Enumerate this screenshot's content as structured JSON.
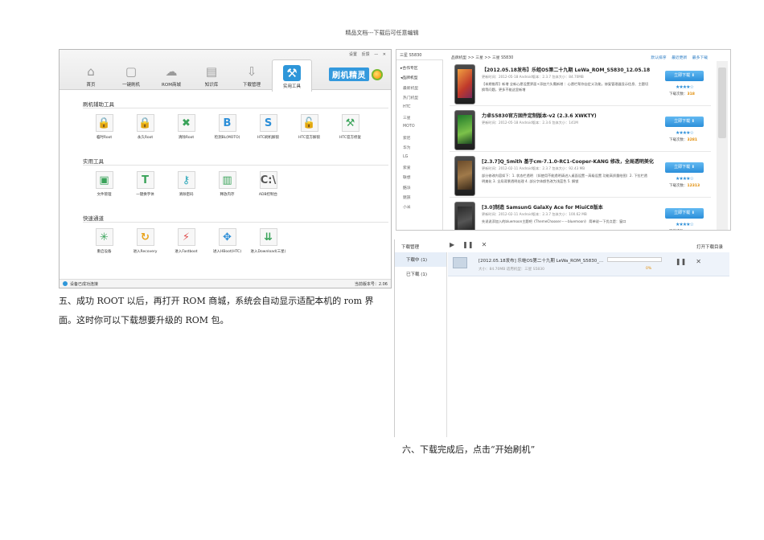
{
  "header": {
    "text": "精品文档---下载后可任意编辑"
  },
  "tool_window": {
    "window_controls": [
      "设置",
      "反馈",
      "—",
      "✕"
    ],
    "nav": [
      {
        "label": "首页",
        "icon": "home-icon",
        "glyph": "⌂"
      },
      {
        "label": "一键刷机",
        "icon": "flash-icon",
        "glyph": "▢"
      },
      {
        "label": "ROM商城",
        "icon": "cloud-download-icon",
        "glyph": "☁"
      },
      {
        "label": "知识库",
        "icon": "document-icon",
        "glyph": "▤"
      },
      {
        "label": "下载管理",
        "icon": "download-icon",
        "glyph": "⇩"
      },
      {
        "label": "实用工具",
        "icon": "tools-icon",
        "glyph": "⚒"
      }
    ],
    "brand": "刷机精灵",
    "sections": [
      {
        "title": "刷机辅助工具",
        "tools": [
          {
            "label": "临时Root",
            "icon": "lock-icon",
            "glyph": "🔒",
            "color": "#e8a21a"
          },
          {
            "label": "永久Root",
            "icon": "lock-icon",
            "glyph": "🔒",
            "color": "#e08a28"
          },
          {
            "label": "清除Root",
            "icon": "android-clear-icon",
            "glyph": "✖",
            "color": "#3aa35a"
          },
          {
            "label": "检测BL(MOTO)",
            "icon": "bootloader-icon",
            "glyph": "B",
            "color": "#2d8fd8"
          },
          {
            "label": "HTC刷机解锁",
            "icon": "s-off-icon",
            "glyph": "S",
            "color": "#2d8fd8"
          },
          {
            "label": "HTC官方解锁",
            "icon": "unlock-icon",
            "glyph": "🔓",
            "color": "#3aa35a"
          },
          {
            "label": "HTC官方修复",
            "icon": "hammer-icon",
            "glyph": "⚒",
            "color": "#3aa35a"
          }
        ]
      },
      {
        "title": "实用工具",
        "tools": [
          {
            "label": "文件管理",
            "icon": "folder-icon",
            "glyph": "▣",
            "color": "#3aa35a"
          },
          {
            "label": "一键换字体",
            "icon": "font-icon",
            "glyph": "T",
            "color": "#3aa35a"
          },
          {
            "label": "清除密码",
            "icon": "key-icon",
            "glyph": "⚷",
            "color": "#2aa6b8"
          },
          {
            "label": "释放内存",
            "icon": "memory-icon",
            "glyph": "▥",
            "color": "#3aa35a"
          },
          {
            "label": "ADB控制台",
            "icon": "console-icon",
            "glyph": "C:\\",
            "color": "#555555"
          }
        ]
      },
      {
        "title": "快速通道",
        "tools": [
          {
            "label": "重启设备",
            "icon": "restart-icon",
            "glyph": "✳",
            "color": "#3aa35a"
          },
          {
            "label": "进入Recovery",
            "icon": "recovery-icon",
            "glyph": "↻",
            "color": "#e8a21a"
          },
          {
            "label": "进入Fastboot",
            "icon": "fastboot-icon",
            "glyph": "⚡",
            "color": "#e05050"
          },
          {
            "label": "进入HBoot(HTC)",
            "icon": "hboot-icon",
            "glyph": "✥",
            "color": "#2d8fd8"
          },
          {
            "label": "进入Download(三星)",
            "icon": "download-mode-icon",
            "glyph": "⇊",
            "color": "#3aa35a"
          }
        ]
      }
    ],
    "status": {
      "text": "设备已成功连接",
      "version": "当前版本号：2.06"
    }
  },
  "step5": {
    "line1": "五、成功 ROOT 以后，再打开 ROM 商城，系统会自动显示适配本机的 rom 界",
    "line2": "面。这时你可以下载想要升级的 ROM 包。"
  },
  "step6": {
    "text": "六、下载完成后，点击“开始刷机”"
  },
  "rom_market": {
    "search": "三星 S5830",
    "sidebar": [
      {
        "label": "▸合作专区",
        "head": true
      },
      {
        "label": "◂品牌机型",
        "head": true
      },
      {
        "label": "最新机型",
        "head": false
      },
      {
        "label": "热门机型",
        "head": false
      },
      {
        "label": "HTC",
        "head": false
      },
      {
        "label": "三星",
        "head": false
      },
      {
        "label": "MOTO",
        "head": false
      },
      {
        "label": "索尼",
        "head": false
      },
      {
        "label": "华为",
        "head": false
      },
      {
        "label": "LG",
        "head": false
      },
      {
        "label": "索爱",
        "head": false
      },
      {
        "label": "联想",
        "head": false
      },
      {
        "label": "酷派",
        "head": false
      },
      {
        "label": "魅族",
        "head": false
      },
      {
        "label": "小米",
        "head": false
      }
    ],
    "breadcrumb": "品牌机型 >> 三星 >> 三星 S5830",
    "sort": [
      "默认排序",
      "最近更新",
      "最多下载"
    ],
    "download_label": "立即下载 ⬇",
    "count_label": "下载次数：",
    "roms": [
      {
        "title": "【2012.05.18发布】乐蛙OS第二十九期 LeWa_ROM_S5830_12.05.18",
        "meta": "更新时间：2012-05-18    Android版本：2.3.7    包体大小：84.70MB",
        "desc": "【本期推荐】新增 全新心愿设置界面+添加六头鹰新增 ：心愿栏帮你自定义功能，修复管理器显示信息、主题切换等问题，更多不能这里新增",
        "count": "318",
        "stars": "★★★★☆",
        "screen": "linear-gradient(135deg,#f0a040,#c0392b 60%,#7a2a5a)"
      },
      {
        "title": "力卓S5830官方固件定制版本-v2 (2.3.6 XWKTY)",
        "meta": "更新时间：2012-05-18    Android版本：2.3.6    包体大小：141M",
        "desc": "",
        "count": "3281",
        "stars": "★★★★☆",
        "screen": "linear-gradient(160deg,#1f7a2a,#7cc24a 60%,#1d4a22)"
      },
      {
        "title": "[2.3.7]Q_Smith 基于cm-7.1.0-RC1-Cooper-KANG 修改，全局透明美化",
        "meta": "更新时间：2012-02-11    Android版本：2.3.7    包体大小：92.43 MB",
        "desc": "部分修改内容如下：1. 状态栏透明 （如使用不能透明请进入桌面设置－高级设置 功能高质量绘图）2. 下拉栏透明美化 3. 全局背景透明处理 4. 部分字体颜色改为浅蓝色 5. 解锁",
        "count": "12313",
        "stars": "★★★★☆",
        "screen": "linear-gradient(160deg,#6b4b2a,#a07a4a 50%,#3a2a1a)"
      },
      {
        "title": "[3.0]制造 SamsunG GalaXy Ace for MiuiC8版本",
        "meta": "更新时间：2012-02-11    Android版本：2.3.7    包体大小：100.62 MB",
        "desc": "先说说添加入的bluemoon主题吧《ThemeChooser－－bluemoon》 简单说一下优点是：窗口",
        "count": "",
        "stars": "★★★★☆",
        "screen": "linear-gradient(160deg,#2a2a2a,#555 50%,#111)"
      }
    ]
  },
  "download_manager": {
    "title": "下载管理",
    "open_dir": "打开下载目录",
    "tabs": [
      {
        "label": "下载中 (1)",
        "active": true
      },
      {
        "label": "已下载 (1)",
        "active": false
      }
    ],
    "item": {
      "name": "[2012.05.18发布] 乐蛙OS第二十九期 LeWa_ROM_S5830_...",
      "sub": "大小：84.70MB    适用机型：三星 S5830",
      "percent": "0%"
    }
  }
}
